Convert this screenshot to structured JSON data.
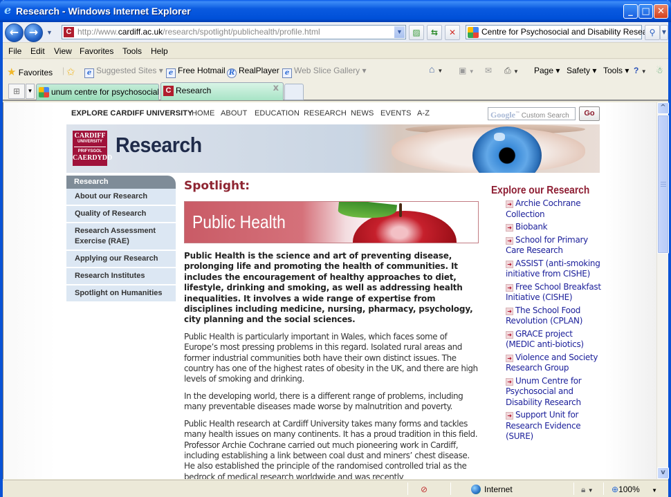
{
  "window": {
    "title": "Research - Windows Internet Explorer",
    "controls": {
      "minimize": "_",
      "maximize": "□",
      "close": "✕"
    }
  },
  "address_bar": {
    "url_prefix": "http://www.",
    "url_domain": "cardiff.ac.uk",
    "url_path": "/research/spotlight/publichealth/profile.html",
    "search_value": "Centre for Psychosocial and Disability Research"
  },
  "menu": [
    "File",
    "Edit",
    "View",
    "Favorites",
    "Tools",
    "Help"
  ],
  "favorites_bar": {
    "favorites_label": "Favorites",
    "suggested_sites": "Suggested Sites",
    "free_hotmail": "Free Hotmail",
    "realplayer": "RealPlayer",
    "web_slice_gallery": "Web Slice Gallery",
    "page": "Page",
    "safety": "Safety",
    "tools": "Tools"
  },
  "tabs": [
    {
      "label": "unum centre for psychosocial...",
      "active": false
    },
    {
      "label": "Research",
      "active": true
    }
  ],
  "site": {
    "topnav": {
      "explore": "EXPLORE CARDIFF UNIVERSITY",
      "links": [
        "HOME",
        "ABOUT",
        "EDUCATION",
        "RESEARCH",
        "NEWS",
        "EVENTS",
        "A-Z"
      ]
    },
    "search": {
      "brand": "Google",
      "placeholder": "Custom Search",
      "go": "Go"
    },
    "logo": {
      "line1": "CARDIFF",
      "line2": "UNIVERSITY",
      "line3": "PRIFYSGOL",
      "line4": "CAERDYDD"
    },
    "banner_title": "Research",
    "left_nav": {
      "heading": "Research",
      "items": [
        "About our Research",
        "Quality of Research",
        "Research Assessment Exercise (RAE)",
        "Applying our Research",
        "Research Institutes",
        "Spotlight on Humanities"
      ]
    },
    "main": {
      "spotlight_title": "Spotlight:",
      "banner_text": "Public Health",
      "lead": "Public Health is the science and art of preventing disease, prolonging life and promoting the health of communities. It includes the encouragement of healthy approaches to diet, lifestyle, drinking and smoking, as well as addressing health inequalities. It involves a wide range of expertise from disciplines including medicine, nursing, pharmacy, psychology, city planning and the social sciences.",
      "paragraphs": [
        "Public Health is particularly important in Wales, which faces some of Europe’s most pressing problems in this regard. Isolated rural areas and former industrial communities both have their own distinct issues. The country has one of the highest rates of obesity in the UK, and there are high levels of smoking and drinking.",
        "In the developing world, there is a different range of problems, including many preventable diseases made worse by malnutrition and poverty.",
        "Public Health research at Cardiff University takes many forms and tackles many health issues on many continents. It has a proud tradition in this field. Professor Archie Cochrane carried out much pioneering work in Cardiff, including establishing a link between coal dust and miners’ chest disease. He also established the principle of the randomised controlled trial as the bedrock of medical research worldwide and was recently"
      ]
    },
    "explore": {
      "heading": "Explore our Research",
      "links": [
        "Archie Cochrane Collection",
        "Biobank",
        "School for Primary Care Research",
        "ASSIST (anti-smoking initiative from CISHE)",
        "Free School Breakfast Initiative (CISHE)",
        "The School Food Revolution (CPLAN)",
        "GRACE project (MEDIC anti-biotics)",
        "Violence and Society Research Group",
        "Unum Centre for Psychosocial and Disability Research",
        "Support Unit for Research Evidence (SURE)"
      ]
    }
  },
  "status_bar": {
    "zone": "Internet",
    "zoom": "100%"
  },
  "colors": {
    "brand_red": "#8e2431",
    "link_blue": "#1b1f9a",
    "nav_bg": "#dce7f3",
    "nav_head": "#7f8c98"
  }
}
